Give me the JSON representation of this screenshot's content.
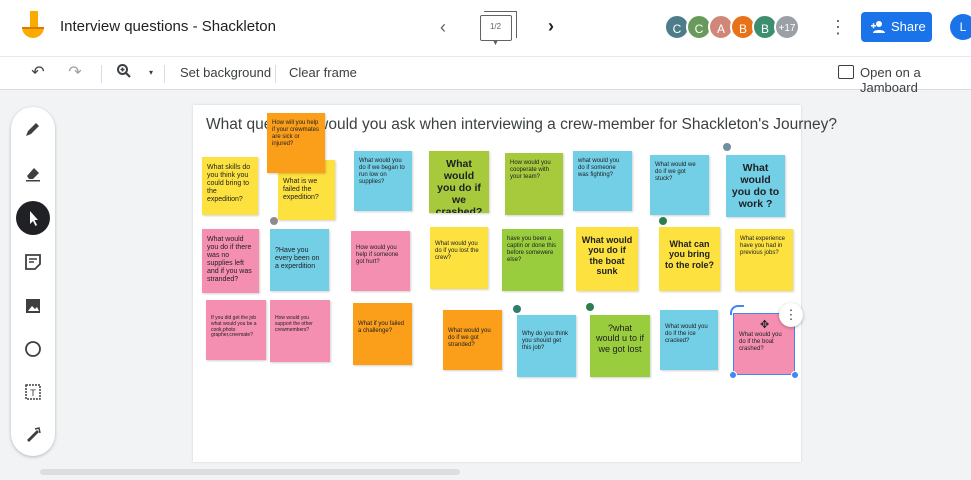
{
  "header": {
    "title": "Interview questions - Shackleton",
    "frame_counter": "1/2",
    "avatars": [
      {
        "initial": "C",
        "color": "#4e7d8a"
      },
      {
        "initial": "C",
        "color": "#6a9a5b"
      },
      {
        "initial": "A",
        "color": "#d0877a"
      },
      {
        "initial": "B",
        "color": "#e8711a"
      },
      {
        "initial": "B",
        "color": "#3b8f6e"
      }
    ],
    "more_count": "+17",
    "share_label": "Share",
    "user_initial": "L"
  },
  "toolbar": {
    "set_background": "Set background",
    "clear_frame": "Clear frame",
    "open_jamboard": "Open on a Jamboard"
  },
  "canvas": {
    "title": "What questions would you ask when interviewing a crew-member for Shackleton's Journey?",
    "notes": [
      {
        "text": "What skills do you think you could bring to the expedition?"
      },
      {
        "text": "How will you help if your crewmates are sick or injured?"
      },
      {
        "text": "What is we failed the expedition?"
      },
      {
        "text": "What would you do if we began to run low on supplies?"
      },
      {
        "text": "What would you do if we crashed?"
      },
      {
        "text": "How would you cooperate with your team?"
      },
      {
        "text": "what would you do if someone was fighting?"
      },
      {
        "text": "What would we do if we got stuck?"
      },
      {
        "text": "What would you do to work ?"
      },
      {
        "text": "What would you do if there was no supplies left and if you was stranded?"
      },
      {
        "text": "?Have you every been on a experdition"
      },
      {
        "text": "How would you help if someone got hurt?"
      },
      {
        "text": "What would you do if you lost the crew?"
      },
      {
        "text": "have you been a captin or done this before somewere else?"
      },
      {
        "text": "What would you do if the boat sunk"
      },
      {
        "text": "What can you bring to the role?"
      },
      {
        "text": "What experience have you had in previous jobs?"
      },
      {
        "text": "If you did get the job what would you be a cook,photo grapher,creemate?"
      },
      {
        "text": "How would you support the other crewmembers?"
      },
      {
        "text": "What if you failed a challenge?"
      },
      {
        "text": "What would you do if we got stranded?"
      },
      {
        "text": "Why do you think you should get this job?"
      },
      {
        "text": "?what would u to if we got lost"
      },
      {
        "text": "What would you do if the ice cracked?"
      },
      {
        "text": "What would you do if the boat crashed?"
      }
    ]
  }
}
